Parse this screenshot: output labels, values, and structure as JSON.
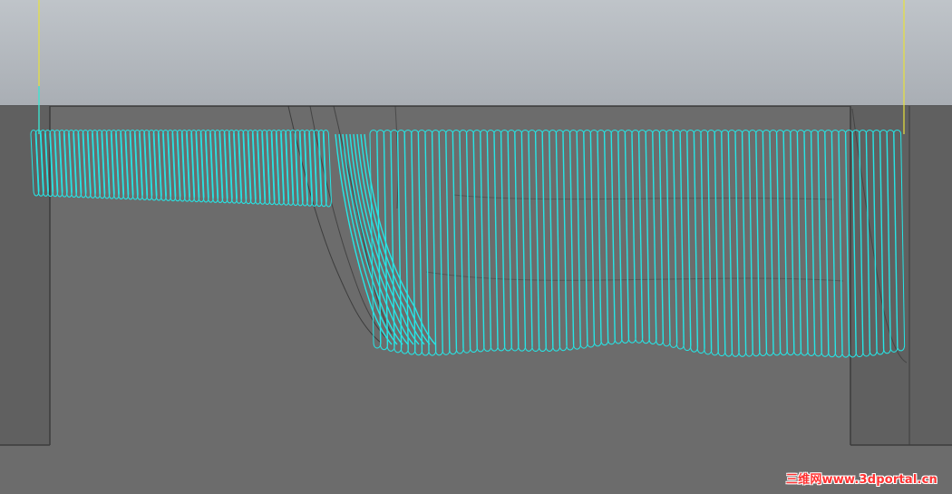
{
  "viewport": {
    "watermark_text": "三维网www.3dportal.cn"
  },
  "colors": {
    "background_upper": "#b3b8be",
    "background_lower": "#6c6c6c",
    "stock_wall": "#5f5f5f",
    "toolpath": "#26e6e6",
    "tool_axis": "#e8e23a",
    "watermark": "#ff3030"
  },
  "icons": {
    "toolpath": "cyan-loop-toolpath",
    "tool_axis": "yellow-vertical-line"
  }
}
